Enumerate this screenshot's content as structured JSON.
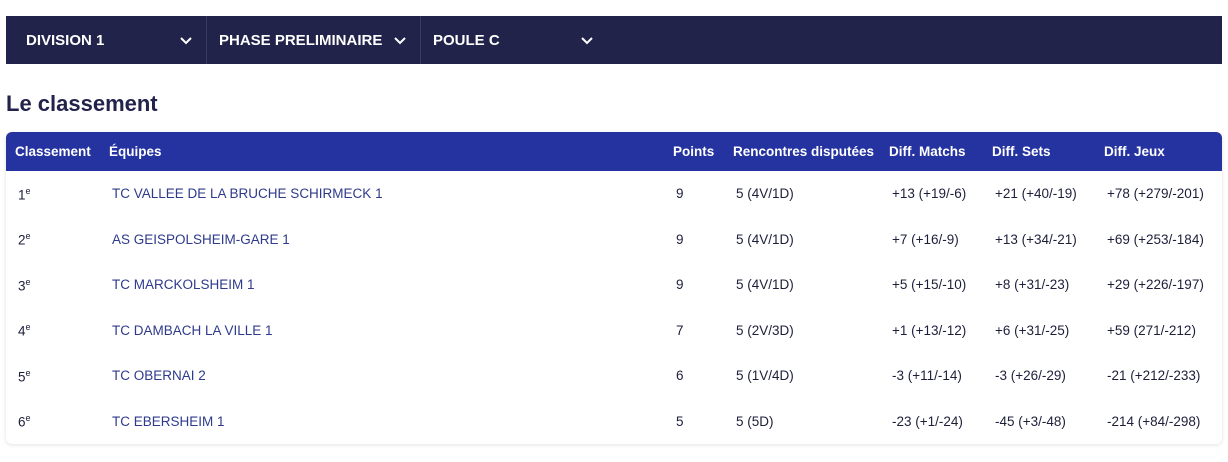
{
  "filters": {
    "division": "DIVISION 1",
    "phase": "PHASE PRELIMINAIRE",
    "poule": "POULE C"
  },
  "title": "Le classement",
  "table": {
    "headers": [
      "Classement",
      "Équipes",
      "Points",
      "Rencontres disputées",
      "Diff. Matchs",
      "Diff. Sets",
      "Diff. Jeux"
    ],
    "rank_suffix": "e",
    "rows": [
      {
        "rank": "1",
        "team": "TC VALLEE DE LA BRUCHE SCHIRMECK 1",
        "points": "9",
        "rencontres": "5 (4V/1D)",
        "matchs": "+13 (+19/-6)",
        "sets": "+21 (+40/-19)",
        "jeux": "+78 (+279/-201)"
      },
      {
        "rank": "2",
        "team": "AS GEISPOLSHEIM-GARE 1",
        "points": "9",
        "rencontres": "5 (4V/1D)",
        "matchs": "+7 (+16/-9)",
        "sets": "+13 (+34/-21)",
        "jeux": "+69 (+253/-184)"
      },
      {
        "rank": "3",
        "team": "TC MARCKOLSHEIM 1",
        "points": "9",
        "rencontres": "5 (4V/1D)",
        "matchs": "+5 (+15/-10)",
        "sets": "+8 (+31/-23)",
        "jeux": "+29 (+226/-197)"
      },
      {
        "rank": "4",
        "team": "TC DAMBACH LA VILLE 1",
        "points": "7",
        "rencontres": "5 (2V/3D)",
        "matchs": "+1 (+13/-12)",
        "sets": "+6 (+31/-25)",
        "jeux": "+59 (271/-212)"
      },
      {
        "rank": "5",
        "team": "TC OBERNAI 2",
        "points": "6",
        "rencontres": "5 (1V/4D)",
        "matchs": "-3 (+11/-14)",
        "sets": "-3 (+26/-29)",
        "jeux": "-21 (+212/-233)"
      },
      {
        "rank": "6",
        "team": "TC EBERSHEIM 1",
        "points": "5",
        "rencontres": "5 (5D)",
        "matchs": "-23 (+1/-24)",
        "sets": "-45 (+3/-48)",
        "jeux": "-214 (+84/-298)"
      }
    ]
  }
}
